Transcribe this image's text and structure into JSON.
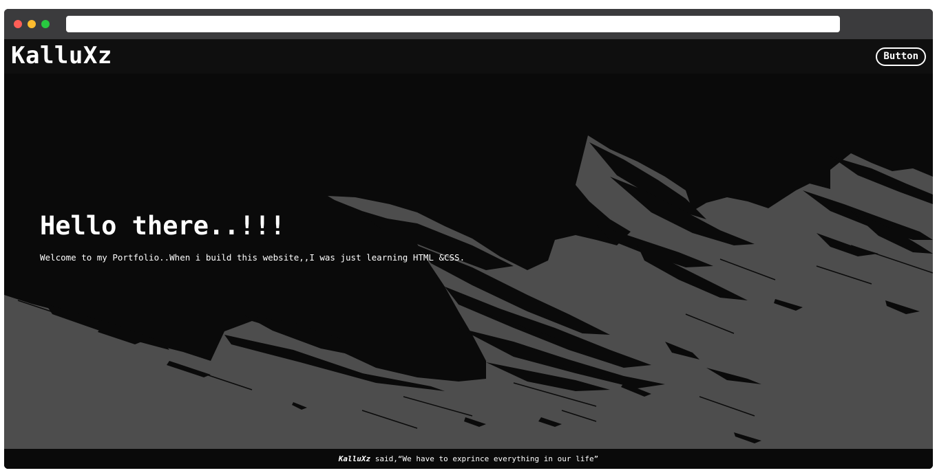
{
  "browser": {
    "url": ""
  },
  "navbar": {
    "logo": "KalluXz",
    "button_label": "Button"
  },
  "hero": {
    "title": "Hello there..!!!",
    "subtitle": "Welcome to my Portfolio..When i build this website,,I was just learning HTML &CSS."
  },
  "footer": {
    "author": "KalluXz",
    "quote": " said,“We have to exprince everything in our life”"
  },
  "colors": {
    "page_background": "#0a0a0a",
    "brush_stroke": "#4d4d4d",
    "titlebar": "#3b3b3d",
    "text": "#ffffff"
  },
  "icons": {
    "close": "close-dot-icon",
    "minimize": "minimize-dot-icon",
    "maximize": "maximize-dot-icon"
  }
}
